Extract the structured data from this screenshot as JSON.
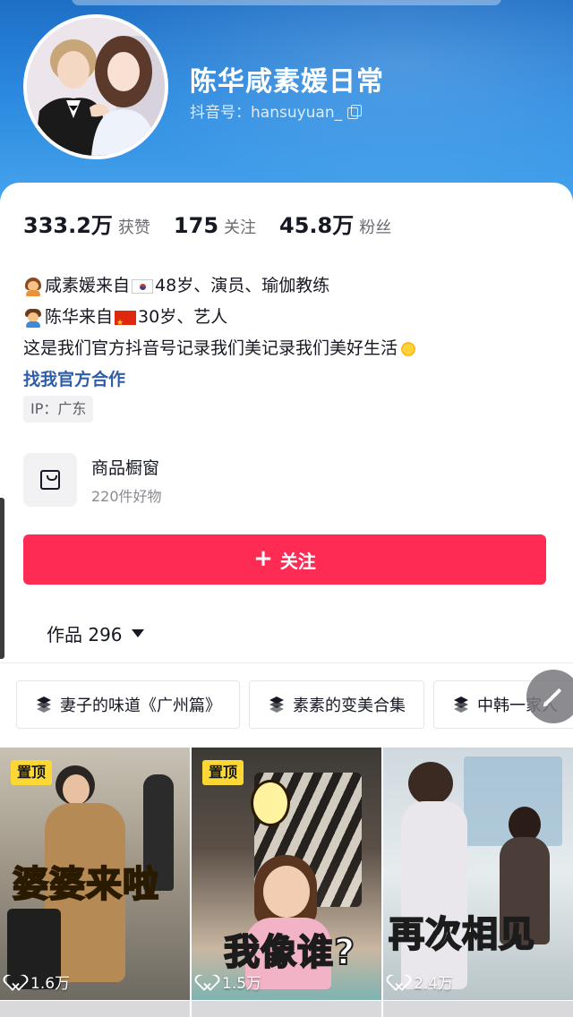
{
  "profile": {
    "nickname": "陈华咸素媛日常",
    "douyin_id": "抖音号：hansuyuan_"
  },
  "stats": [
    {
      "num": "333.2万",
      "label": "获赞"
    },
    {
      "num": "175",
      "label": "关注"
    },
    {
      "num": "45.8万",
      "label": "粉丝"
    }
  ],
  "bio": {
    "line1": "咸素媛来自",
    "line1_tail": "48岁、演员、瑜伽教练",
    "line2": "陈华来自",
    "line2_tail": "30岁、艺人",
    "line3": "这是我们官方抖音号记录我们美记录我们美好生活",
    "link": "找我官方合作"
  },
  "ip_tag": "IP：广东",
  "shop": {
    "title": "商品橱窗",
    "subtitle": "220件好物"
  },
  "follow_button": {
    "label": "关注"
  },
  "works_tab": {
    "label": "作品 296"
  },
  "collections": [
    {
      "label": "妻子的味道《广州篇》"
    },
    {
      "label": "素素的变美合集"
    },
    {
      "label": "中韩一家人"
    }
  ],
  "videos": [
    {
      "pinned": "置顶",
      "caption": "婆婆来啦",
      "likes": "1.6万"
    },
    {
      "pinned": "置顶",
      "caption": "我像谁?",
      "likes": "1.5万"
    },
    {
      "pinned": "",
      "caption": "再次相见",
      "likes": "2.4万"
    }
  ],
  "icons": {
    "copy": "copy-icon",
    "bag": "shopping-bag-icon",
    "plus": "plus-icon",
    "caret": "caret-down-icon",
    "layers": "layers-icon",
    "edit": "pencil-icon",
    "heart": "heart-icon"
  },
  "colors": {
    "accent": "#fe2c55",
    "link": "#2e5ea8",
    "header": "#2b8ae0",
    "pinned_badge": "#fdd835"
  }
}
